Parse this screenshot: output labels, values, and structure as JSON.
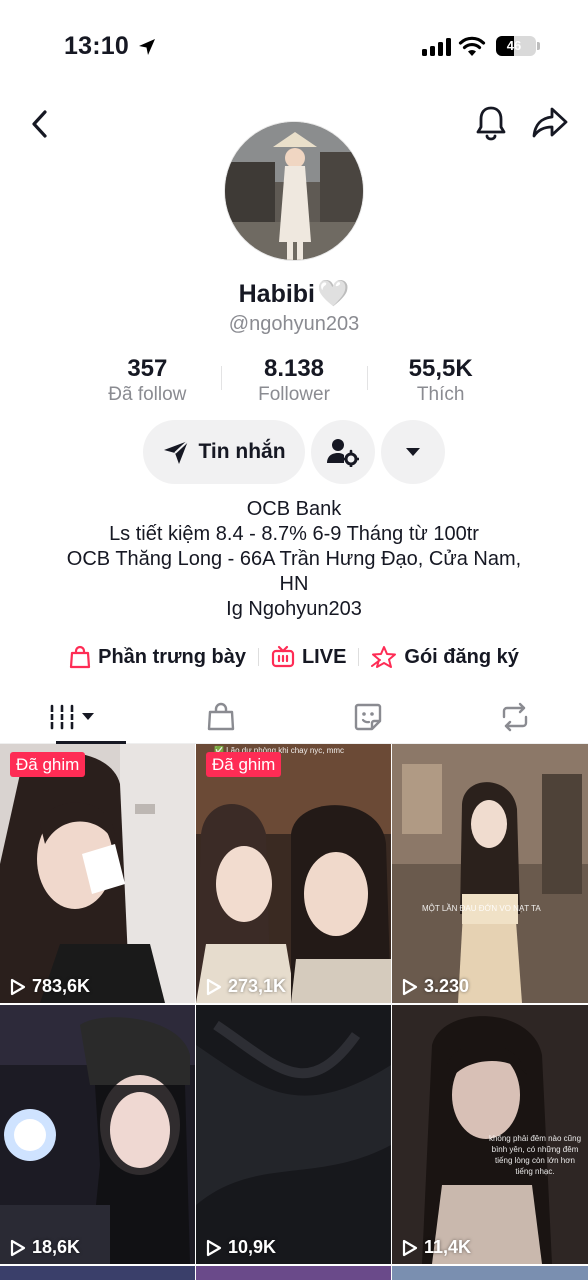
{
  "status_bar": {
    "time": "13:10",
    "battery": "46",
    "battery_level": 0.46
  },
  "profile": {
    "name": "Habibi",
    "name_emoji": "🤍",
    "username": "@ngohyun203",
    "stats": [
      {
        "value": "357",
        "label": "Đã follow"
      },
      {
        "value": "8.138",
        "label": "Follower"
      },
      {
        "value": "55,5K",
        "label": "Thích"
      }
    ],
    "message_button": "Tin nhắn",
    "bio": [
      "OCB Bank",
      "Ls tiết kiệm 8.4 - 8.7% 6-9 Tháng từ 100tr",
      "OCB Thăng Long - 66A Trần Hưng Đạo, Cửa Nam,",
      "HN",
      "Ig Ngohyun203"
    ]
  },
  "links": [
    {
      "label": "Phần trưng bày",
      "icon": "shopping-bag-icon"
    },
    {
      "label": "LIVE",
      "icon": "live-tv-icon"
    },
    {
      "label": "Gói đăng ký",
      "icon": "subscription-star-icon"
    }
  ],
  "tabs": [
    {
      "name": "videos",
      "icon": "grid-bars-icon",
      "active": true
    },
    {
      "name": "shop",
      "icon": "shopping-bag-icon",
      "active": false
    },
    {
      "name": "stickers",
      "icon": "sticker-icon",
      "active": false
    },
    {
      "name": "reposts",
      "icon": "repost-icon",
      "active": false
    }
  ],
  "videos": [
    {
      "views": "783,6K",
      "pinned_label": "Đã ghim"
    },
    {
      "views": "273,1K",
      "pinned_label": "Đã ghim",
      "caption": "✅ Lão dự phòng khi chay nyc, mmc"
    },
    {
      "views": "3.230",
      "caption": "MỘT LẦN ĐAU ĐỚN VO NẠT TA"
    },
    {
      "views": "18,6K"
    },
    {
      "views": "10,9K"
    },
    {
      "views": "11,4K",
      "caption": "không phải đêm nào cũng bình yên, có những đêm tiếng lòng còn lớn hơn tiếng nhạc."
    }
  ],
  "colors": {
    "accent": "#fe2c55",
    "text": "#161823",
    "secondary": "#8a8b91",
    "button_bg": "#f1f1f2"
  }
}
